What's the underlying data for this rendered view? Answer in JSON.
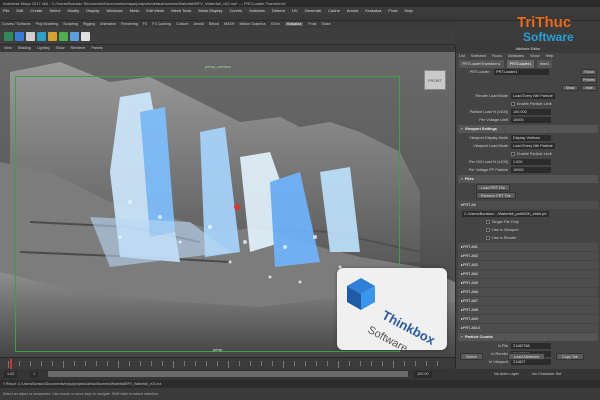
{
  "window": {
    "title": "Autodesk Maya 2017 x64 : C:/Users/Borislav Shumovski/Documents/maya/projects/default/scenes/Waterfall/BFV_Waterfall_v02.ma* --- FRCLoader:Transform1"
  },
  "menubar": [
    "File",
    "Edit",
    "Create",
    "Select",
    "Modify",
    "Display",
    "Windows",
    "Mesh",
    "Edit Mesh",
    "Mesh Tools",
    "Mesh Display",
    "Curves",
    "Surfaces",
    "Deform",
    "UV",
    "Generate",
    "Cache",
    "Arnold",
    "Krakatoa",
    "Frost",
    "Help"
  ],
  "shelf_tabs": [
    "Curves / Surfaces",
    "Poly Modeling",
    "Sculpting",
    "Rigging",
    "Animation",
    "Rendering",
    "FX",
    "FX Caching",
    "Custom",
    "Arnold",
    "Bifrost",
    "MASH",
    "Motion Graphics",
    "XGen",
    "Krakatoa",
    "Frost",
    "Stoke"
  ],
  "shelf_tabs_active": "Krakatoa",
  "shelf_buttons": [
    {
      "color": "#2e8b57"
    },
    {
      "color": "#3a7bd5"
    },
    {
      "color": "#d0d0d0"
    },
    {
      "color": "#2aa1c9"
    },
    {
      "color": "#d8a030"
    },
    {
      "color": "#4caf50"
    },
    {
      "color": "#5c9ee0"
    },
    {
      "color": "#e0e0e0"
    }
  ],
  "viewport": {
    "menu": [
      "View",
      "Shading",
      "Lighting",
      "Show",
      "Renderer",
      "Panels"
    ],
    "camera_label": "persp_camera",
    "footer_label": "persp",
    "viewcube_label": "FRONT"
  },
  "timeline": {
    "start": "1",
    "end": "120",
    "current": "1",
    "range_start": "1.00",
    "range_end": "120.00",
    "anim_layer": "No Anim Layer",
    "char_set": "No Character Set"
  },
  "command_line": "// Result: C:/Users/Borislav/Documents/maya/projects/default/scenes/Waterfall/BFV_Waterfall_v02.ma",
  "help_line": "Select an object or component. Use mouse or arrow keys to navigate. Shift+click to extend selection.",
  "attribute_editor": {
    "header": "Attribute Editor",
    "menu": [
      "List",
      "Selected",
      "Focus",
      "Attributes",
      "Show",
      "Help"
    ],
    "node_tabs": [
      "PRTLoaderTransform1",
      "PRTLoader1",
      "time1"
    ],
    "active_tab": "PRTLoader1",
    "node_name_label": "PRTLoader:",
    "node_name_value": "PRTLoader1",
    "focus_btn": "Focus",
    "presets_btn": "Presets",
    "show_btn": "Show",
    "hide_btn": "Hide",
    "top_rows": [
      {
        "label": "Render Load Mode",
        "value": "Load Every Nth Particle"
      },
      {
        "label": "",
        "value": "Enable Particle Limit",
        "check": true
      },
      {
        "label": "Particle Load % (x100)",
        "value": "100.000"
      },
      {
        "label": "Per Voltage Limit",
        "value": "10000"
      }
    ],
    "viewport_settings": {
      "title": "Viewport Settings",
      "rows": [
        {
          "label": "Viewport Display Mode",
          "value": "Display Vertices"
        },
        {
          "label": "Viewport Load Mode",
          "value": "Load Every Nth Particle"
        },
        {
          "label": "",
          "value": "Enable Particle Limit",
          "check": true
        },
        {
          "label": "Per 100 Load % (x100)",
          "value": "1.000"
        },
        {
          "label": "Per Voltage PF Particle",
          "value": "10000"
        }
      ]
    },
    "files": {
      "title": "Files",
      "buttons": [
        "Load PRT File",
        "Remove PRT File"
      ]
    },
    "prt_sections": [
      "PRT-All",
      "PRT-All1",
      "PRT-All2",
      "PRT-All3",
      "PRT-All4",
      "PRT-All5",
      "PRT-All6",
      "PRT-All7",
      "PRT-All8",
      "PRT-All9",
      "PRT-All10"
    ],
    "prt_all_path": "C:/Users/Borislav/.../Waterfall_part0000_####.prt",
    "source_checks": [
      "Single File Only",
      "Use in Viewport",
      "Use in Render"
    ],
    "particle_counts": {
      "title": "Particle Counts",
      "rows": [
        {
          "label": "In File",
          "value": "21182768"
        },
        {
          "label": "In Render",
          "value": "21182768"
        },
        {
          "label": "In Viewport",
          "value": "211827"
        }
      ]
    },
    "bottom_buttons": [
      "Select",
      "Load Attributes",
      "Copy Tab"
    ]
  },
  "logos": {
    "trithuc_line1": "TriThuc",
    "trithuc_line2": "Software",
    "thinkbox_line1": "Thinkbox",
    "thinkbox_line2": "Software"
  }
}
